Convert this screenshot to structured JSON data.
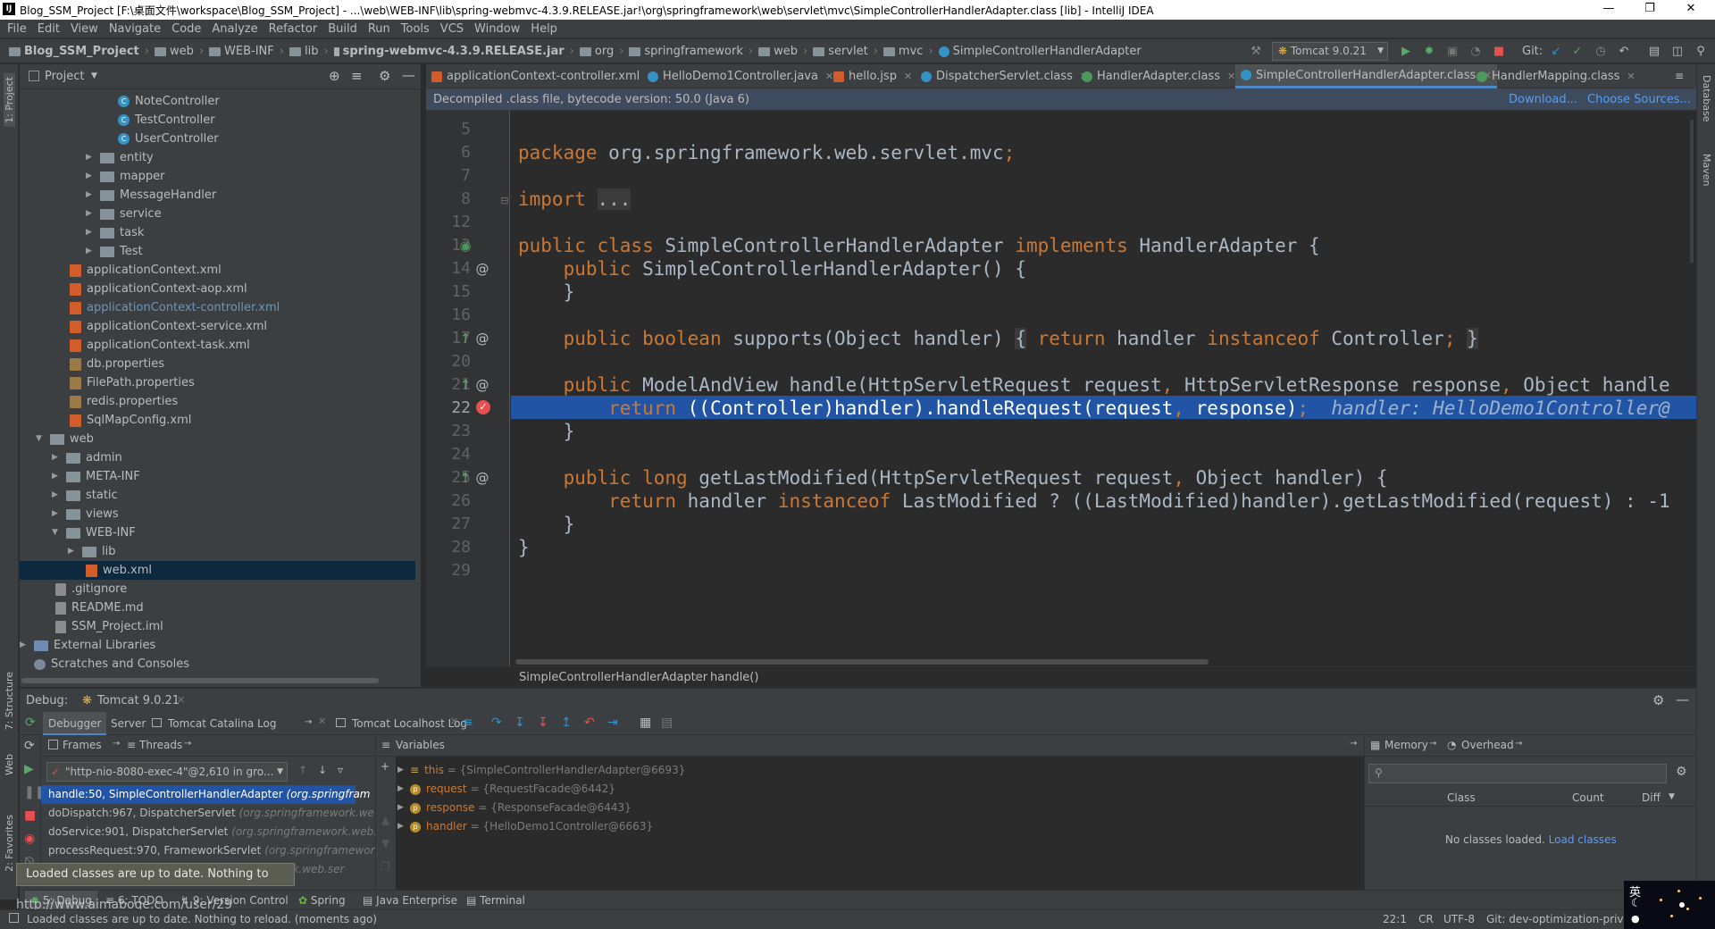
{
  "window": {
    "title": "Blog_SSM_Project [F:\\桌面文件\\workspace\\Blog_SSM_Project] - ...\\web\\WEB-INF\\lib\\spring-webmvc-4.3.9.RELEASE.jar!\\org\\springframework\\web\\servlet\\mvc\\SimpleControllerHandlerAdapter.class [lib] - IntelliJ IDEA"
  },
  "menu": [
    "File",
    "Edit",
    "View",
    "Navigate",
    "Code",
    "Analyze",
    "Refactor",
    "Build",
    "Run",
    "Tools",
    "VCS",
    "Window",
    "Help"
  ],
  "breadcrumbs": [
    "Blog_SSM_Project",
    "web",
    "WEB-INF",
    "lib",
    "spring-webmvc-4.3.9.RELEASE.jar",
    "org",
    "springframework",
    "web",
    "servlet",
    "mvc",
    "SimpleControllerHandlerAdapter"
  ],
  "toolbar": {
    "run_config": "Tomcat 9.0.21",
    "git_label": "Git:"
  },
  "project": {
    "header": "Project",
    "tree": [
      {
        "label": "NoteController",
        "type": "class"
      },
      {
        "label": "TestController",
        "type": "class"
      },
      {
        "label": "UserController",
        "type": "class"
      },
      {
        "label": "entity",
        "type": "folder"
      },
      {
        "label": "mapper",
        "type": "folder"
      },
      {
        "label": "MessageHandler",
        "type": "folder"
      },
      {
        "label": "service",
        "type": "folder"
      },
      {
        "label": "task",
        "type": "folder"
      },
      {
        "label": "Test",
        "type": "folder"
      },
      {
        "label": "applicationContext.xml",
        "type": "xml"
      },
      {
        "label": "applicationContext-aop.xml",
        "type": "xml"
      },
      {
        "label": "applicationContext-controller.xml",
        "type": "xml"
      },
      {
        "label": "applicationContext-service.xml",
        "type": "xml"
      },
      {
        "label": "applicationContext-task.xml",
        "type": "xml"
      },
      {
        "label": "db.properties",
        "type": "prop"
      },
      {
        "label": "FilePath.properties",
        "type": "prop"
      },
      {
        "label": "redis.properties",
        "type": "prop"
      },
      {
        "label": "SqlMapConfig.xml",
        "type": "xml"
      },
      {
        "label": "web",
        "type": "folder"
      },
      {
        "label": "admin",
        "type": "folder"
      },
      {
        "label": "META-INF",
        "type": "folder"
      },
      {
        "label": "static",
        "type": "folder"
      },
      {
        "label": "views",
        "type": "folder"
      },
      {
        "label": "WEB-INF",
        "type": "folder"
      },
      {
        "label": "lib",
        "type": "folder"
      },
      {
        "label": "web.xml",
        "type": "xml"
      },
      {
        "label": ".gitignore",
        "type": "text"
      },
      {
        "label": "README.md",
        "type": "text"
      },
      {
        "label": "SSM_Project.iml",
        "type": "text"
      },
      {
        "label": "External Libraries",
        "type": "lib"
      },
      {
        "label": "Scratches and Consoles",
        "type": "scratch"
      }
    ]
  },
  "editor_tabs": [
    {
      "label": "applicationContext-controller.xml",
      "color": "#d35c2b"
    },
    {
      "label": "HelloDemo1Controller.java",
      "color": "#3592c4"
    },
    {
      "label": "hello.jsp",
      "color": "#d35c2b"
    },
    {
      "label": "DispatcherServlet.class",
      "color": "#3592c4"
    },
    {
      "label": "HandlerAdapter.class",
      "color": "#4c9a5b"
    },
    {
      "label": "SimpleControllerHandlerAdapter.class",
      "color": "#3592c4",
      "active": true
    },
    {
      "label": "HandlerMapping.class",
      "color": "#4c9a5b"
    }
  ],
  "notice": {
    "text": "Decompiled .class file, bytecode version: 50.0 (Java 6)",
    "download": "Download...",
    "choose_sources": "Choose Sources..."
  },
  "code": {
    "line_numbers": [
      "5",
      "6",
      "7",
      "8",
      "12",
      "13",
      "14",
      "15",
      "16",
      "17",
      "20",
      "21",
      "22",
      "23",
      "24",
      "25",
      "26",
      "27",
      "28",
      "29"
    ],
    "current_line": "22",
    "breadcrumb_class": "SimpleControllerHandlerAdapter",
    "breadcrumb_method": "handle()"
  },
  "debug": {
    "label": "Debug:",
    "session": "Tomcat 9.0.21",
    "tabs": [
      "Debugger",
      "Server",
      "Tomcat Catalina Log",
      "Tomcat Localhost Log"
    ],
    "frames_label": "Frames",
    "threads_label": "Threads",
    "thread_selector": "\"http-nio-8080-exec-4\"@2,610 in gro...",
    "frames": [
      {
        "method": "handle:50, SimpleControllerHandlerAdapter",
        "pkg": "(org.springfram",
        "selected": true
      },
      {
        "method": "doDispatch:967, DispatcherServlet",
        "pkg": "(org.springframework.we"
      },
      {
        "method": "doService:901, DispatcherServlet",
        "pkg": "(org.springframework.web."
      },
      {
        "method": "processRequest:970, FrameworkServlet",
        "pkg": "(org.springframewor"
      },
      {
        "method": "",
        "pkg": "ework.web.ser"
      }
    ],
    "variables_label": "Variables",
    "variables": [
      {
        "name": "this",
        "value": "= {SimpleControllerHandlerAdapter@6693}"
      },
      {
        "name": "request",
        "value": "= {RequestFacade@6442}"
      },
      {
        "name": "response",
        "value": "= {ResponseFacade@6443}"
      },
      {
        "name": "handler",
        "value": "= {HelloDemo1Controller@6663}"
      }
    ],
    "memory_label": "Memory",
    "overhead_label": "Overhead",
    "memory_cols": [
      "Class",
      "Count",
      "Diff"
    ],
    "memory_empty": "No classes loaded.",
    "load_classes": "Load classes"
  },
  "tooltip": "Loaded classes are up to date. Nothing to reload.",
  "bottom_tabs": [
    "5: Debug",
    "6: TODO",
    "9: Version Control",
    "Spring",
    "Java Enterprise",
    "Terminal"
  ],
  "status": {
    "message": "Loaded classes are up to date. Nothing to reload. (moments ago)",
    "position": "22:1",
    "line_sep": "CR",
    "encoding": "UTF-8",
    "git_branch": "Git: dev-optimization-priv"
  },
  "watermark": "http://www.aimaboge.com/user/29",
  "tray": {
    "ime": "英"
  },
  "left_strip": [
    "1: Project",
    "7: Structure",
    "Web",
    "2: Favorites"
  ],
  "right_strip": [
    "Database",
    "Maven"
  ]
}
